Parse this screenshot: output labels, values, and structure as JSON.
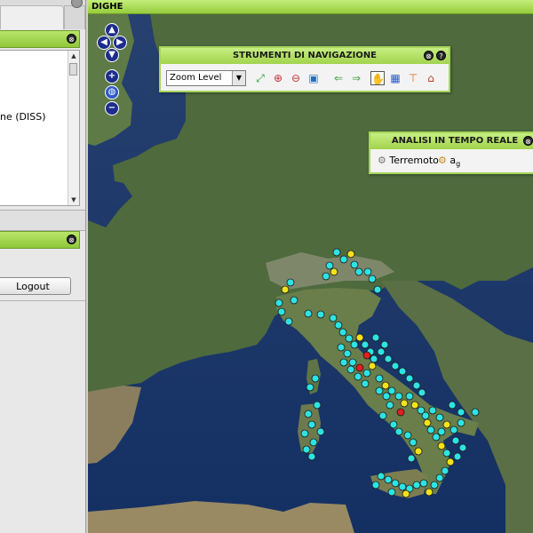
{
  "map_panel": {
    "title": "DIGHE"
  },
  "left_panel": {
    "layers": {
      "partial_item": "ne (DISS)"
    },
    "logout_label": "Logout"
  },
  "nav_toolbar": {
    "title": "STRUMENTI DI NAVIGAZIONE",
    "zoom_select_value": "Zoom Level",
    "tools": [
      "zoom-extent-icon",
      "zoom-in-icon",
      "zoom-out-icon",
      "zoom-box-icon",
      "back-arrow-icon",
      "forward-arrow-icon",
      "pan-hand-icon",
      "select-icon",
      "measure-icon",
      "home-icon"
    ]
  },
  "analysis_toolbar": {
    "title": "ANALISI IN TEMPO REALE",
    "item1": "Terremoto",
    "item2_main": "a",
    "item2_sub": "g"
  },
  "colors": {
    "panel_green": "#a2d34d",
    "dam_cyan": "#2ee3e3",
    "dam_yellow": "#f2e21a",
    "dam_red": "#e02020"
  }
}
